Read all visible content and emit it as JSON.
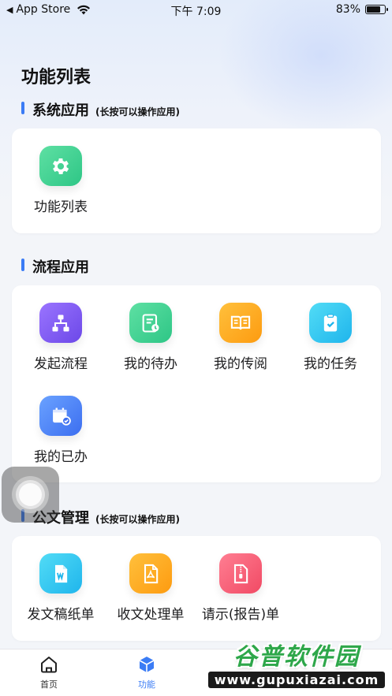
{
  "status_bar": {
    "back_app": "App Store",
    "time": "下午 7:09",
    "battery_text": "83%",
    "battery_level": 0.83
  },
  "page": {
    "title": "功能列表"
  },
  "sections": [
    {
      "title": "系统应用",
      "hint": "(长按可以操作应用)",
      "apps": [
        {
          "label": "功能列表",
          "icon": "gear-icon",
          "color": "#2ec686"
        }
      ]
    },
    {
      "title": "流程应用",
      "hint": "",
      "apps": [
        {
          "label": "发起流程",
          "icon": "flowchart-icon",
          "color": "#6c48e8"
        },
        {
          "label": "我的待办",
          "icon": "todo-document-icon",
          "color": "#2ec686"
        },
        {
          "label": "我的传阅",
          "icon": "open-book-icon",
          "color": "#fd9b10"
        },
        {
          "label": "我的任务",
          "icon": "task-clipboard-icon",
          "color": "#1fb5ec"
        },
        {
          "label": "我的已办",
          "icon": "calendar-check-icon",
          "color": "#3c6ef0"
        }
      ]
    },
    {
      "title": "公文管理",
      "hint": "(长按可以操作应用)",
      "apps": [
        {
          "label": "发文稿纸单",
          "icon": "word-document-icon",
          "color": "#1fb5ec"
        },
        {
          "label": "收文处理单",
          "icon": "pdf-document-icon",
          "color": "#fd9b10"
        },
        {
          "label": "请示(报告)单",
          "icon": "zip-document-icon",
          "color": "#f14a64"
        }
      ]
    }
  ],
  "tab_bar": [
    {
      "label": "首页",
      "icon": "home-icon",
      "active": false
    },
    {
      "label": "功能",
      "icon": "cube-icon",
      "active": true
    }
  ],
  "colors": {
    "accent": "#3b7cf5",
    "background": "#f3f5f9"
  },
  "watermark": {
    "title": "谷普软件园",
    "url": "www.gupuxiazai.com"
  }
}
